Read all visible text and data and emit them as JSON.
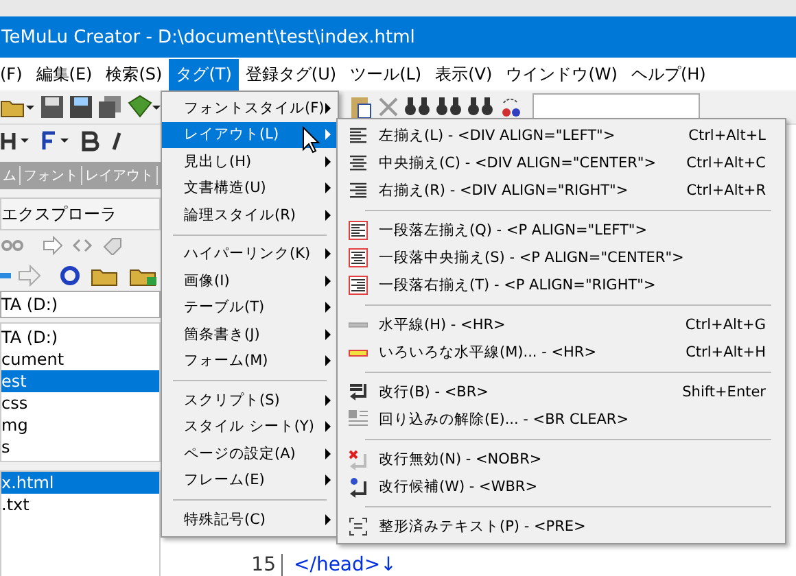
{
  "window": {
    "title": "TeMuLu Creator - D:\\document\\test\\index.html"
  },
  "menubar": [
    {
      "label": "(F)",
      "selected": false
    },
    {
      "label": "編集(E)",
      "selected": false
    },
    {
      "label": "検索(S)",
      "selected": false
    },
    {
      "label": "タグ(T)",
      "selected": true
    },
    {
      "label": "登録タグ(U)",
      "selected": false
    },
    {
      "label": "ツール(L)",
      "selected": false
    },
    {
      "label": "表示(V)",
      "selected": false
    },
    {
      "label": "ウインドウ(W)",
      "selected": false
    },
    {
      "label": "ヘルプ(H)",
      "selected": false
    }
  ],
  "tabs": [
    {
      "label": "ム"
    },
    {
      "label": "フォント"
    },
    {
      "label": "レイアウト"
    }
  ],
  "explorer": {
    "title": "エクスプローラ",
    "drive": "TA (D:)",
    "folders": [
      {
        "label": "TA (D:)",
        "selected": false
      },
      {
        "label": "cument",
        "selected": false
      },
      {
        "label": "est",
        "selected": true
      },
      {
        "label": "css",
        "selected": false
      },
      {
        "label": "mg",
        "selected": false
      },
      {
        "label": "s",
        "selected": false
      }
    ],
    "files": [
      {
        "label": "x.html",
        "selected": true
      },
      {
        "label": ".txt",
        "selected": false
      }
    ]
  },
  "editor": {
    "line_number": "15",
    "last_line": "</head>↓"
  },
  "tag_menu": [
    {
      "kind": "item",
      "label": "フォントスタイル(F)",
      "selected": false
    },
    {
      "kind": "item",
      "label": "レイアウト(L)",
      "selected": true
    },
    {
      "kind": "item",
      "label": "見出し(H)",
      "selected": false
    },
    {
      "kind": "item",
      "label": "文書構造(U)",
      "selected": false
    },
    {
      "kind": "item",
      "label": "論理スタイル(R)",
      "selected": false
    },
    {
      "kind": "separator"
    },
    {
      "kind": "item",
      "label": "ハイパーリンク(K)",
      "selected": false
    },
    {
      "kind": "item",
      "label": "画像(I)",
      "selected": false
    },
    {
      "kind": "item",
      "label": "テーブル(T)",
      "selected": false
    },
    {
      "kind": "item",
      "label": "箇条書き(J)",
      "selected": false
    },
    {
      "kind": "item",
      "label": "フォーム(M)",
      "selected": false
    },
    {
      "kind": "separator"
    },
    {
      "kind": "item",
      "label": "スクリプト(S)",
      "selected": false
    },
    {
      "kind": "item",
      "label": "スタイル シート(Y)",
      "selected": false
    },
    {
      "kind": "item",
      "label": "ページの設定(A)",
      "selected": false
    },
    {
      "kind": "item",
      "label": "フレーム(E)",
      "selected": false
    },
    {
      "kind": "separator"
    },
    {
      "kind": "item",
      "label": "特殊記号(C)",
      "selected": false
    }
  ],
  "layout_menu": [
    {
      "kind": "item",
      "label": "左揃え(L) - <DIV ALIGN=\"LEFT\">",
      "shortcut": "Ctrl+Alt+L"
    },
    {
      "kind": "item",
      "label": "中央揃え(C) - <DIV ALIGN=\"CENTER\">",
      "shortcut": "Ctrl+Alt+C"
    },
    {
      "kind": "item",
      "label": "右揃え(R) - <DIV ALIGN=\"RIGHT\">",
      "shortcut": "Ctrl+Alt+R"
    },
    {
      "kind": "separator"
    },
    {
      "kind": "item",
      "label": "一段落左揃え(Q) - <P ALIGN=\"LEFT\">"
    },
    {
      "kind": "item",
      "label": "一段落中央揃え(S) - <P ALIGN=\"CENTER\">"
    },
    {
      "kind": "item",
      "label": "一段落右揃え(T) - <P ALIGN=\"RIGHT\">"
    },
    {
      "kind": "separator"
    },
    {
      "kind": "item",
      "label": "水平線(H) - <HR>",
      "shortcut": "Ctrl+Alt+G"
    },
    {
      "kind": "item",
      "label": "いろいろな水平線(M)... - <HR>",
      "shortcut": "Ctrl+Alt+H"
    },
    {
      "kind": "separator"
    },
    {
      "kind": "item",
      "label": "改行(B) - <BR>",
      "shortcut": "Shift+Enter"
    },
    {
      "kind": "item",
      "label": "回り込みの解除(E)... - <BR CLEAR>"
    },
    {
      "kind": "separator"
    },
    {
      "kind": "item",
      "label": "改行無効(N) - <NOBR>"
    },
    {
      "kind": "item",
      "label": "改行候補(W) - <WBR>"
    },
    {
      "kind": "separator"
    },
    {
      "kind": "item",
      "label": "整形済みテキスト(P) - <PRE>"
    }
  ]
}
